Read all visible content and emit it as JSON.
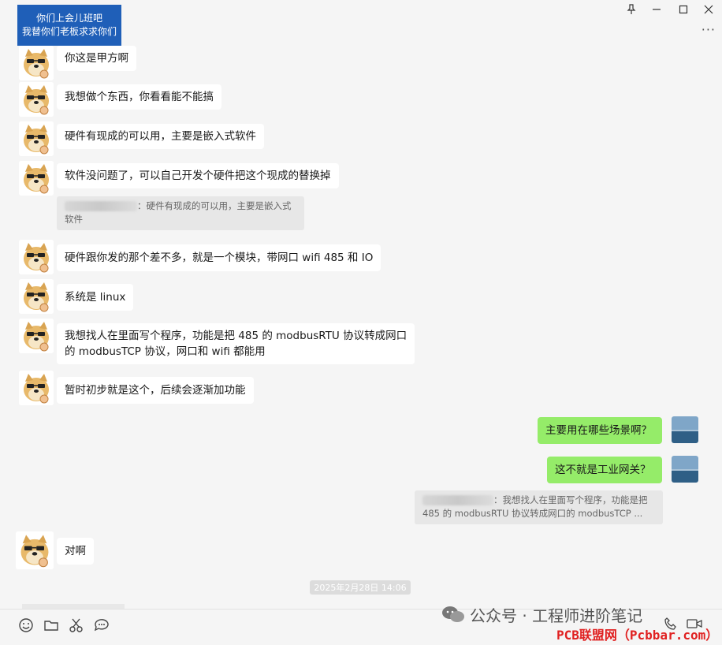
{
  "window": {
    "badge_line1": "你们上会儿班吧",
    "badge_line2": "我替你们老板求求你们",
    "pin_icon": "pin-icon",
    "minimize_icon": "minimize-icon",
    "maximize_icon": "maximize-icon",
    "close_icon": "close-icon",
    "more_label": "···"
  },
  "messages": [
    {
      "side": "left",
      "text": "你这是甲方啊"
    },
    {
      "side": "left",
      "text": "我想做个东西，你看看能不能搞"
    },
    {
      "side": "left",
      "text": "硬件有现成的可以用，主要是嵌入式软件"
    },
    {
      "side": "left",
      "text": "软件没问题了，可以自己开发个硬件把这个现成的替换掉",
      "quote": "：硬件有现成的可以用，主要是嵌入式软件"
    },
    {
      "side": "left",
      "text": "硬件跟你发的那个差不多，就是一个模块，带网口 wifi 485 和 IO"
    },
    {
      "side": "left",
      "text": "系统是 linux"
    },
    {
      "side": "left",
      "text_line1": "我想找人在里面写个程序，功能是把 485 的 modbusRTU 协议转成网口",
      "text_line2": "的 modbusTCP 协议，网口和 wifi 都能用"
    },
    {
      "side": "left",
      "text": "暂时初步就是这个，后续会逐渐加功能"
    },
    {
      "side": "right",
      "text": "主要用在哪些场景啊？"
    },
    {
      "side": "right",
      "text": "这不就是工业网关？",
      "quote_line1": "：我想找人在里面写个程序，功能是把",
      "quote_line2": "485 的 modbusRTU 协议转成网口的 modbusTCP ..."
    },
    {
      "side": "left",
      "text": "对啊"
    }
  ],
  "timestamp": "2025年2月28日 14:06",
  "toolbar": {
    "emoji_icon": "emoji-icon",
    "folder_icon": "folder-icon",
    "scissors_icon": "scissors-icon",
    "chat_icon": "chat-bubble-icon",
    "phone_icon": "phone-icon",
    "video_icon": "video-call-icon"
  },
  "watermark": {
    "text": "公众号 · 工程师进阶笔记",
    "site": "PCB联盟网（Pcbbar.com）"
  },
  "colors": {
    "badge": "#1f5fb8",
    "my_bubble": "#95ec69",
    "their_bubble": "#ffffff",
    "background": "#f5f5f5",
    "site_mark": "#e02020"
  }
}
